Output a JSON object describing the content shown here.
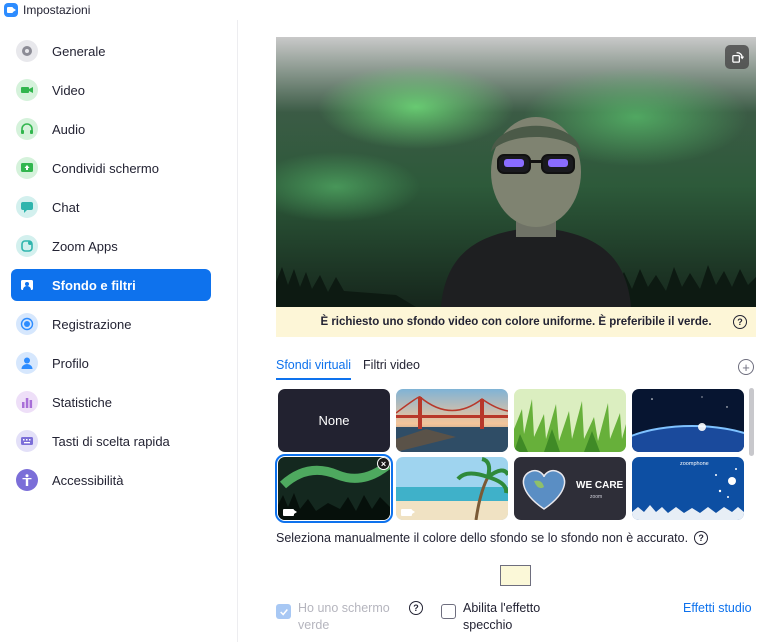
{
  "window": {
    "title": "Impostazioni"
  },
  "sidebar": {
    "items": [
      {
        "label": "Generale",
        "icon": "gear-icon",
        "color": "#6E7681"
      },
      {
        "label": "Video",
        "icon": "video-camera-icon",
        "color": "#32B64E"
      },
      {
        "label": "Audio",
        "icon": "headphones-icon",
        "color": "#32B64E"
      },
      {
        "label": "Condividi schermo",
        "icon": "share-screen-icon",
        "color": "#32B64E"
      },
      {
        "label": "Chat",
        "icon": "chat-bubble-icon",
        "color": "#2FB5AD"
      },
      {
        "label": "Zoom Apps",
        "icon": "zoom-apps-icon",
        "color": "#2FB5AD"
      },
      {
        "label": "Sfondo e filtri",
        "icon": "background-filter-icon",
        "color": "#0E72ED",
        "active": true
      },
      {
        "label": "Registrazione",
        "icon": "record-icon",
        "color": "#2D8CFF"
      },
      {
        "label": "Profilo",
        "icon": "profile-icon",
        "color": "#2D8CFF"
      },
      {
        "label": "Statistiche",
        "icon": "statistics-icon",
        "color": "#A86ED8"
      },
      {
        "label": "Tasti di scelta rapida",
        "icon": "keyboard-icon",
        "color": "#7B6ED8"
      },
      {
        "label": "Accessibilità",
        "icon": "accessibility-icon",
        "color": "#7B6ED8"
      }
    ]
  },
  "main": {
    "warning": "È richiesto uno sfondo video con colore uniforme. È preferibile il verde.",
    "tabs": [
      {
        "label": "Sfondi virtuali",
        "active": true
      },
      {
        "label": "Filtri video",
        "active": false
      }
    ],
    "thumbnails": [
      {
        "label": "None",
        "kind": "none"
      },
      {
        "kind": "golden-gate"
      },
      {
        "kind": "grass"
      },
      {
        "kind": "earth"
      },
      {
        "kind": "aurora",
        "selected": true
      },
      {
        "kind": "beach"
      },
      {
        "kind": "we-care",
        "text": "WE CARE",
        "subtext": "zoom"
      },
      {
        "kind": "zoom-phone",
        "text": "zoomphone"
      }
    ],
    "hint": "Seleziona manualmente il colore dello sfondo se lo sfondo non è accurato.",
    "swatch_color": "#FBF8D8",
    "green_screen_label": "Ho uno schermo verde",
    "mirror_label": "Abilita l'effetto specchio",
    "studio_link": "Effetti studio"
  },
  "colors": {
    "accent": "#0E72ED",
    "warning_bg": "#FDF6D7"
  }
}
